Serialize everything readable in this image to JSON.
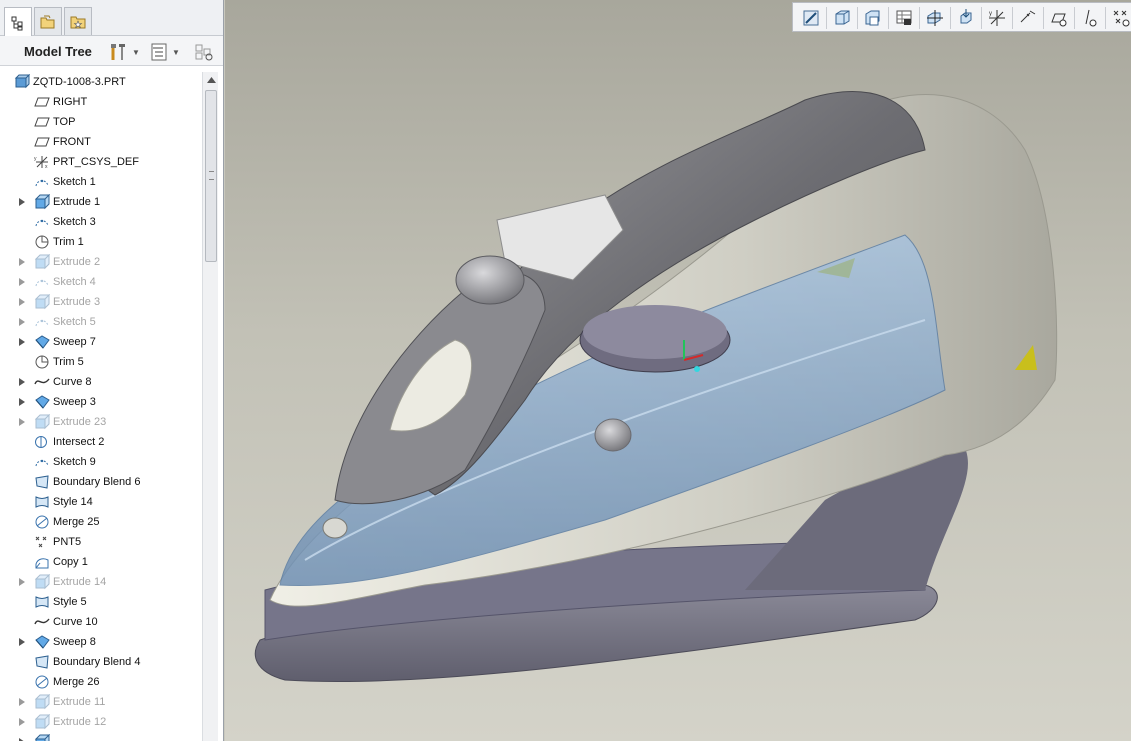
{
  "model_tree": {
    "title": "Model Tree",
    "items": [
      {
        "label": "ZQTD-1008-3.PRT",
        "icon": "part-icon",
        "expandable": false,
        "suppressed": false,
        "root": true
      },
      {
        "label": "RIGHT",
        "icon": "datum-plane-icon",
        "expandable": false,
        "suppressed": false
      },
      {
        "label": "TOP",
        "icon": "datum-plane-icon",
        "expandable": false,
        "suppressed": false
      },
      {
        "label": "FRONT",
        "icon": "datum-plane-icon",
        "expandable": false,
        "suppressed": false
      },
      {
        "label": "PRT_CSYS_DEF",
        "icon": "csys-icon",
        "expandable": false,
        "suppressed": false
      },
      {
        "label": "Sketch 1",
        "icon": "sketch-icon",
        "expandable": false,
        "suppressed": false
      },
      {
        "label": "Extrude 1",
        "icon": "extrude-icon",
        "expandable": true,
        "suppressed": false
      },
      {
        "label": "Sketch 3",
        "icon": "sketch-icon",
        "expandable": false,
        "suppressed": false
      },
      {
        "label": "Trim 1",
        "icon": "trim-icon",
        "expandable": false,
        "suppressed": false
      },
      {
        "label": "Extrude 2",
        "icon": "extrude-icon",
        "expandable": true,
        "suppressed": true
      },
      {
        "label": "Sketch 4",
        "icon": "sketch-icon",
        "expandable": true,
        "suppressed": true
      },
      {
        "label": "Extrude 3",
        "icon": "extrude-icon",
        "expandable": true,
        "suppressed": true
      },
      {
        "label": "Sketch 5",
        "icon": "sketch-icon",
        "expandable": true,
        "suppressed": true
      },
      {
        "label": "Sweep 7",
        "icon": "sweep-icon",
        "expandable": true,
        "suppressed": false
      },
      {
        "label": "Trim 5",
        "icon": "trim-icon",
        "expandable": false,
        "suppressed": false
      },
      {
        "label": "Curve 8",
        "icon": "curve-icon",
        "expandable": true,
        "suppressed": false
      },
      {
        "label": "Sweep 3",
        "icon": "sweep-icon",
        "expandable": true,
        "suppressed": false
      },
      {
        "label": "Extrude 23",
        "icon": "extrude-icon",
        "expandable": true,
        "suppressed": true
      },
      {
        "label": "Intersect 2",
        "icon": "intersect-icon",
        "expandable": false,
        "suppressed": false
      },
      {
        "label": "Sketch 9",
        "icon": "sketch-icon",
        "expandable": false,
        "suppressed": false
      },
      {
        "label": "Boundary Blend 6",
        "icon": "boundary-blend-icon",
        "expandable": false,
        "suppressed": false
      },
      {
        "label": "Style 14",
        "icon": "style-icon",
        "expandable": false,
        "suppressed": false
      },
      {
        "label": "Merge 25",
        "icon": "merge-icon",
        "expandable": false,
        "suppressed": false
      },
      {
        "label": "PNT5",
        "icon": "datum-point-icon",
        "expandable": false,
        "suppressed": false
      },
      {
        "label": "Copy 1",
        "icon": "copy-icon",
        "expandable": false,
        "suppressed": false
      },
      {
        "label": "Extrude 14",
        "icon": "extrude-icon",
        "expandable": true,
        "suppressed": true
      },
      {
        "label": "Style 5",
        "icon": "style-icon",
        "expandable": false,
        "suppressed": false
      },
      {
        "label": "Curve 10",
        "icon": "curve-icon",
        "expandable": false,
        "suppressed": false
      },
      {
        "label": "Sweep 8",
        "icon": "sweep-icon",
        "expandable": true,
        "suppressed": false
      },
      {
        "label": "Boundary Blend 4",
        "icon": "boundary-blend-icon",
        "expandable": false,
        "suppressed": false
      },
      {
        "label": "Merge 26",
        "icon": "merge-icon",
        "expandable": false,
        "suppressed": false
      },
      {
        "label": "Extrude 11",
        "icon": "extrude-icon",
        "expandable": true,
        "suppressed": true
      },
      {
        "label": "Extrude 12",
        "icon": "extrude-icon",
        "expandable": true,
        "suppressed": true
      },
      {
        "label": "",
        "icon": "extrude-icon",
        "expandable": true,
        "suppressed": false
      }
    ]
  },
  "panel_tabs": [
    "model-tree-tab-icon",
    "folder-browser-tab-icon",
    "favorites-tab-icon"
  ],
  "header_tools": [
    "tree-settings-icon",
    "tree-filter-icon",
    "show-columns-icon"
  ],
  "view_toolbar": [
    "repaint-icon",
    "zoom-fit-icon",
    "view-orient-icon",
    "saved-views-icon",
    "spin-center-icon",
    "datum-display-icon",
    "csys-display-icon",
    "plane-display-icon",
    "axis-display-icon",
    "point-display-icon",
    "csys-tag-display-icon"
  ],
  "colors": {
    "viewport_bg": "#c2c1b6",
    "shell_gray": "#7f7f84",
    "handle_cream": "#d9d8cf",
    "water_tank_blue": "#7d9dbf",
    "sole_plate": "#6e6d7c",
    "suppressed_text": "#a4a4a4"
  }
}
